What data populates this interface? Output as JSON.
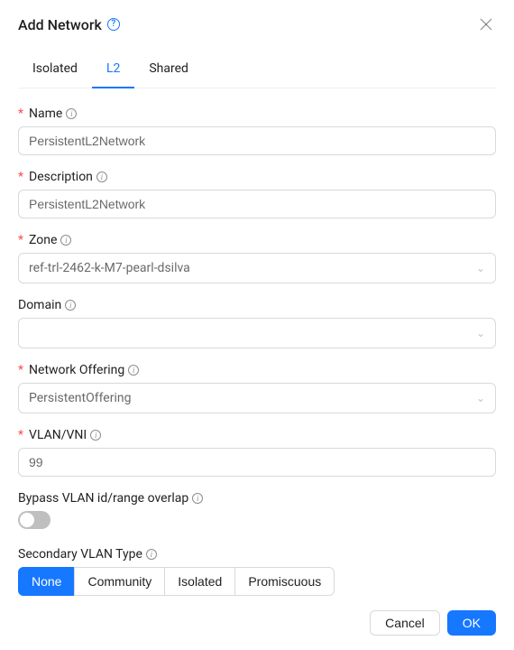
{
  "dialog": {
    "title": "Add Network"
  },
  "tabs": {
    "isolated": "Isolated",
    "l2": "L2",
    "shared": "Shared",
    "active": "l2"
  },
  "fields": {
    "name": {
      "label": "Name",
      "value": "PersistentL2Network",
      "required": true
    },
    "description": {
      "label": "Description",
      "value": "PersistentL2Network",
      "required": true
    },
    "zone": {
      "label": "Zone",
      "value": "ref-trl-2462-k-M7-pearl-dsilva",
      "required": true
    },
    "domain": {
      "label": "Domain",
      "value": "",
      "required": false
    },
    "network_offering": {
      "label": "Network Offering",
      "value": "PersistentOffering",
      "required": true
    },
    "vlan_vni": {
      "label": "VLAN/VNI",
      "value": "99",
      "required": true
    },
    "bypass_overlap": {
      "label": "Bypass VLAN id/range overlap",
      "value": false
    },
    "secondary_vlan_type": {
      "label": "Secondary VLAN Type",
      "options": {
        "none": "None",
        "community": "Community",
        "isolated": "Isolated",
        "promiscuous": "Promiscuous"
      },
      "selected": "none"
    }
  },
  "footer": {
    "cancel": "Cancel",
    "ok": "OK"
  }
}
